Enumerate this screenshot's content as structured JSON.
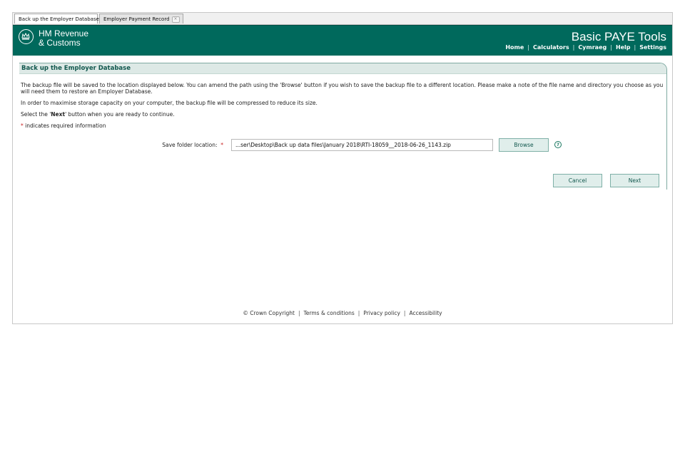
{
  "tabs": [
    {
      "label": "Back up the Employer Database"
    },
    {
      "label": "Employer Payment Record"
    }
  ],
  "header": {
    "brand_line1": "HM Revenue",
    "brand_line2": "& Customs",
    "app_title": "Basic PAYE Tools",
    "nav": [
      "Home",
      "Calculators",
      "Cymraeg",
      "Help",
      "Settings"
    ]
  },
  "panel": {
    "title": "Back up the Employer Database",
    "para1": "The backup file will be saved to the location displayed below. You can amend the path using the 'Browse' button if you wish to save the backup file to a different location. Please make a note of the file name and directory you choose as you will need them to restore an Employer Database.",
    "para2": "In order to maximise storage capacity on your computer, the backup file will be compressed to reduce its size.",
    "para3_pre": "Select the '",
    "para3_bold": "Next",
    "para3_post": "' button when you are ready to continue.",
    "req_marker": "*",
    "req_note": " indicates required information"
  },
  "form": {
    "save_label": "Save folder location:",
    "save_value": "...ser\\Desktop\\Back up data files\\January 2018\\RTI-18059__2018-06-26_1143.zip",
    "browse_label": "Browse",
    "help_glyph": "?"
  },
  "actions": {
    "cancel_label": "Cancel",
    "next_label": "Next"
  },
  "footer": {
    "links": [
      "© Crown Copyright",
      "Terms & conditions",
      "Privacy policy",
      "Accessibility"
    ]
  },
  "colors": {
    "brand_green": "#00695c",
    "panel_head_bg": "#dde9e6",
    "required_red": "#c81e1e"
  },
  "icons": [
    "crown-logo-icon",
    "help-icon",
    "close-icon"
  ]
}
